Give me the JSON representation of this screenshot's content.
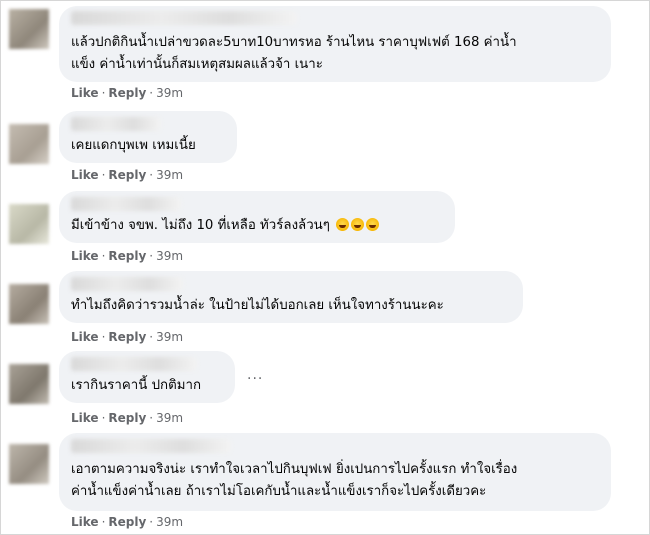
{
  "actions": {
    "like": "Like",
    "reply": "Reply",
    "separator": "·"
  },
  "comments": [
    {
      "text": "แล้วปกติกินน้ำเปล่าขวดละ5บาท10บาทรหอ ร้านไหน ราคาบุฟเฟต์ 168 ค่าน้ำ\nแข็ง ค่าน้ำเท่านั้นก็สมเหตุสมผลแล้วจ้า เนาะ",
      "time": "39m"
    },
    {
      "text": "เคยแดกบุพเพ เหมเนี้ย",
      "time": "39m"
    },
    {
      "text": "มีเข้าข้าง จขพ. ไม่ถึง 10 ที่เหลือ ทัวร์ลงล้วนๆ",
      "emoji": "laughing-crying-face-icon",
      "time": "39m"
    },
    {
      "text": "ทำไมถึงคิดว่ารวมน้ำล่ะ ในป้ายไม่ได้บอกเลย เห็นใจทางร้านนะคะ",
      "time": "39m"
    },
    {
      "text": "เรากินราคานี้ ปกติมาก",
      "more": "···",
      "time": "39m"
    },
    {
      "text": "เอาตามความจริงน่ะ เราทำใจเวลาไปกินบุฟเฟ ยิ่งเปนการไปครั้งแรก ทำใจเรื่อง\nค่าน้ำแข็งค่าน้ำเลย ถ้าเราไม่โอเคกับน้ำและน้ำแข็งเราก็จะไปครั้งเดียวคะ",
      "time": "39m"
    }
  ]
}
